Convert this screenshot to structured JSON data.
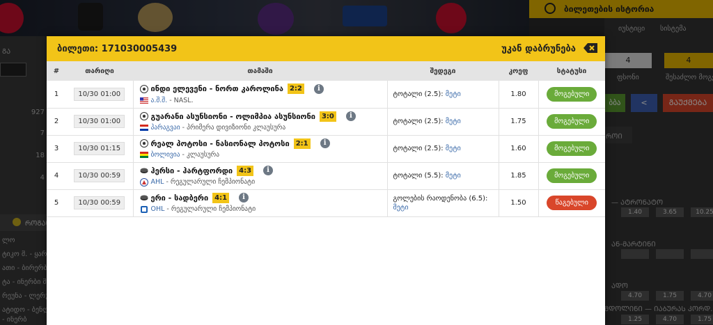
{
  "background": {
    "banner_logos": [
      "NHL",
      "SACRAMENTO KINGS",
      "NBA",
      "WIZARDS"
    ],
    "history_label": "ბილეთების ისტორია",
    "right_tabs": [
      "იუსტიცი",
      "სისტემა"
    ],
    "right_values": [
      "4",
      "4"
    ],
    "right_captions": [
      "ფსონი",
      "შესაძლო მოგება"
    ],
    "right_buttons": [
      "ბბა",
      "ᲒᲐᲣᲥᲛᲔᲑᲐ"
    ],
    "right_section": "ᲠᲝᲘ",
    "right_rows": [
      {
        "label": "— ᲐᲢᲠᲝᲜᲐᲢᲝ",
        "odds": [
          "1.40",
          "3.65",
          "10.25"
        ]
      },
      {
        "label": "ᲐᲜ-ᲛᲐᲠᲢᲘᲜᲘ",
        "odds": [
          "",
          "",
          ""
        ]
      },
      {
        "label": "ᲐᲓᲝ",
        "odds": [
          "4.70",
          "1.75",
          "4.70"
        ]
      },
      {
        "label": "ᲛᲓᲝᲚᲘᲜᲘ — ᲘᲐᲑᲣᲠᲐᲡ ᲙᲝᲠᲓ...",
        "odds": [
          "1.25",
          "4.70",
          "1.75"
        ]
      }
    ],
    "left_labels": [
      "ᲒᲐ",
      "927",
      "7",
      "18",
      "4"
    ],
    "left_section": "ᲠᲝᲒᲐᲜ",
    "left_rows": [
      "ლო",
      "ტიკო მ. - ყარბა",
      "ათი - ბირერბი მ",
      "ტა - ინერბი მ.",
      "რეუნა - ლერუტი",
      "ატიდო - ბენლლა",
      "- ინერბ"
    ]
  },
  "modal": {
    "ticket_label": "ბილეთი:",
    "ticket_number": "171030005439",
    "back_label": "უკან დაბრუნება",
    "columns": [
      "#",
      "თარიღი",
      "თამაში",
      "შედეგი",
      "კოეფ",
      "სტატუსი"
    ],
    "rows": [
      {
        "num": "1",
        "date": "10/30 01:00",
        "sport": "soccer",
        "teams": "ინდი ელევენი - ნორთ კაროლინა",
        "score": "2:2",
        "flag": "us",
        "country": "ა.შ.შ.",
        "league": "- NASL.",
        "market": "ტოტალი (2.5):",
        "selection": "მეტი",
        "odd": "1.80",
        "status": "მოგებული",
        "status_type": "won"
      },
      {
        "num": "2",
        "date": "10/30 01:00",
        "sport": "soccer",
        "teams": "გუარანი ასუნსიონი - ოლიმპია ასუნსიონი",
        "score": "3:0",
        "flag": "py",
        "country": "პარაგვაი",
        "league": "- პრიმერა დივიზიონი კლაუსურა",
        "market": "ტოტალი (2.5):",
        "selection": "მეტი",
        "odd": "1.75",
        "status": "მოგებული",
        "status_type": "won"
      },
      {
        "num": "3",
        "date": "10/30 01:15",
        "sport": "soccer",
        "teams": "რეალ პოტოსი - ნასიონალ პოტოსი",
        "score": "2:1",
        "flag": "bo",
        "country": "ბოლივია",
        "league": "- კლაუსურა",
        "market": "ტოტალი (2.5):",
        "selection": "მეტი",
        "odd": "1.60",
        "status": "მოგებული",
        "status_type": "won"
      },
      {
        "num": "4",
        "date": "10/30 00:59",
        "sport": "hockey",
        "teams": "ჰერსი - ჰარტფორდი",
        "score": "4:3",
        "flag": "ahl",
        "country": "AHL",
        "league": "- რეგულარული ჩემპიონატი",
        "market": "ტოტალი (5.5):",
        "selection": "მეტი",
        "odd": "1.85",
        "status": "მოგებული",
        "status_type": "won"
      },
      {
        "num": "5",
        "date": "10/30 00:59",
        "sport": "hockey",
        "teams": "ერი - სადბერი",
        "score": "4:1",
        "flag": "ohl",
        "country": "OHL",
        "league": "- რეგულარული ჩემპიონატი",
        "market": "გოლების რაოდენობა (6.5):",
        "selection": "მეტი",
        "odd": "1.50",
        "status": "წაგებული",
        "status_type": "lost"
      }
    ]
  },
  "colors": {
    "accent": "#f2c418",
    "won": "#6aab3a",
    "lost": "#d9462a",
    "link": "#3868a8"
  }
}
